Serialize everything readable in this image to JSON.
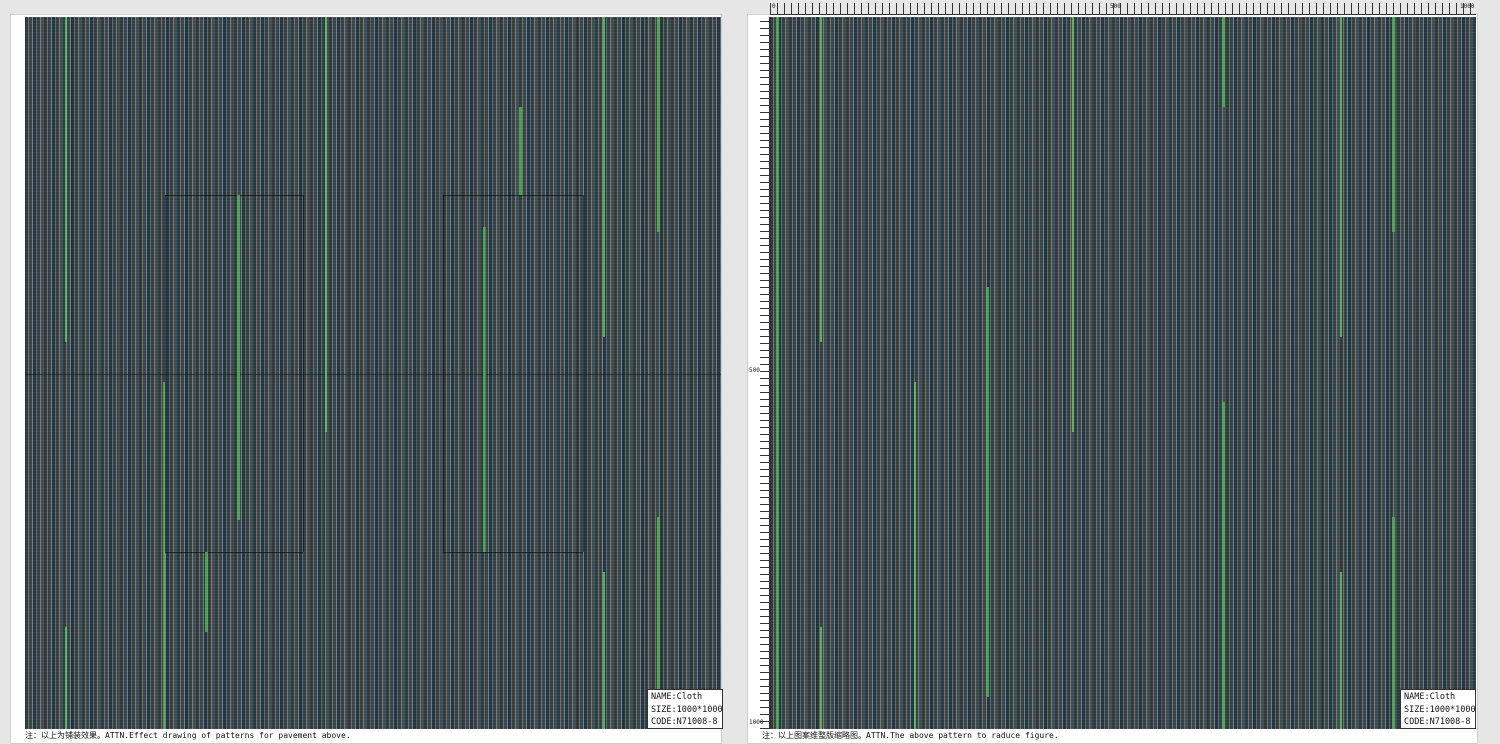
{
  "left_panel": {
    "info": {
      "name": "NAME:Cloth",
      "size": "SIZE:1000*1000",
      "code": "CODE:N71008-8"
    },
    "caption": "注：以上为铺装效果。ATTN.Effect drawing of patterns for pavement above."
  },
  "right_panel": {
    "info": {
      "name": "NAME:Cloth",
      "size": "SIZE:1000*1000",
      "code": "CODE:N71008-8"
    },
    "caption": "注：以上图案维整版缩略图。ATTN.The above pattern to raduce figure.",
    "ruler": {
      "top_start": "0",
      "top_mid": "500",
      "top_end": "1000",
      "left_mid": "500",
      "left_end": "1000"
    }
  },
  "colors": {
    "base": "#2c3a41",
    "brown_stripe": "#7f6a58",
    "gray_stripe": "#6e7f86",
    "green_stripe": "#4fb04f"
  }
}
